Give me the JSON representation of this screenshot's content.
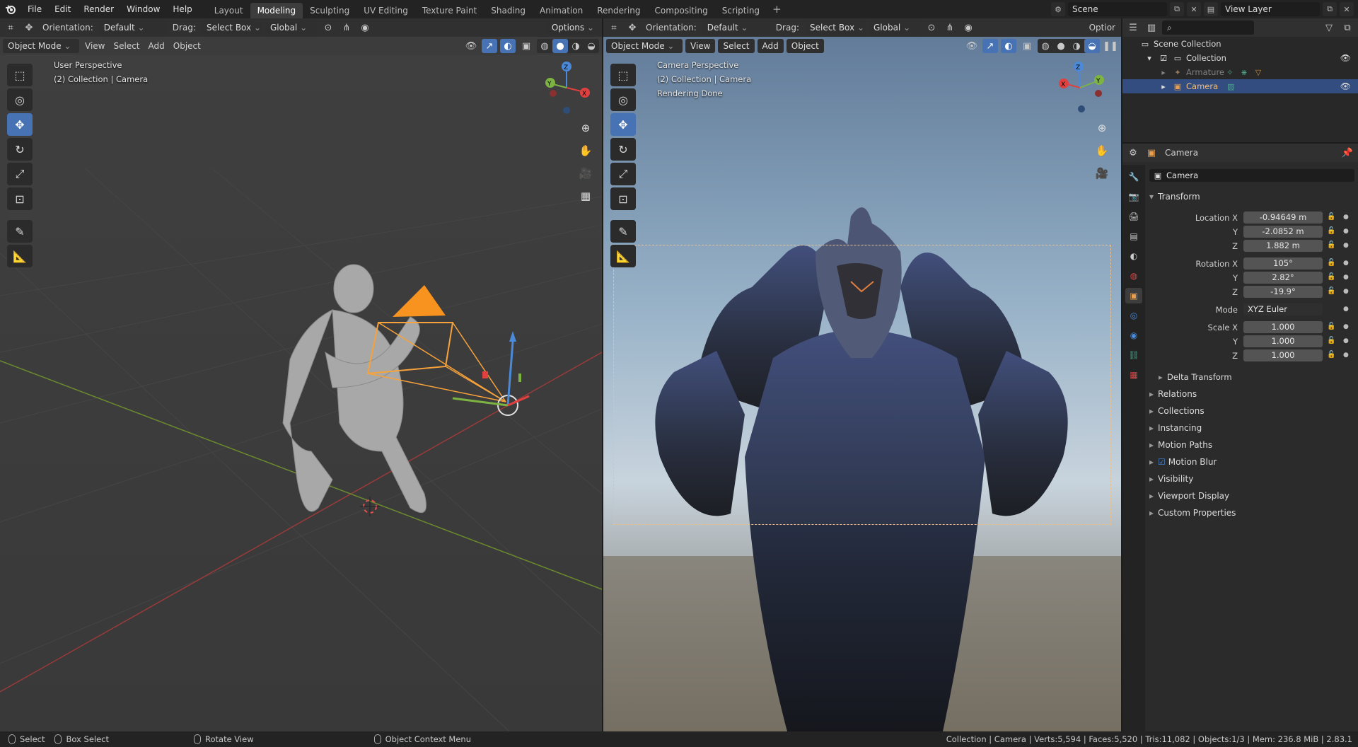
{
  "menubar": {
    "items": [
      "File",
      "Edit",
      "Render",
      "Window",
      "Help"
    ],
    "workspaces": [
      "Layout",
      "Modeling",
      "Sculpting",
      "UV Editing",
      "Texture Paint",
      "Shading",
      "Animation",
      "Rendering",
      "Compositing",
      "Scripting"
    ],
    "active_workspace": "Modeling",
    "add_tab": "+",
    "scene": "Scene",
    "view_layer": "View Layer"
  },
  "viewport_left": {
    "header": {
      "orientation_label": "Orientation:",
      "orientation_value": "Default",
      "drag_label": "Drag:",
      "drag_value": "Select Box",
      "transform_space": "Global",
      "options": "Options",
      "mode": "Object Mode",
      "view": "View",
      "select": "Select",
      "add": "Add",
      "object": "Object"
    },
    "overlay": {
      "perspective": "User Perspective",
      "context": "(2) Collection | Camera"
    }
  },
  "viewport_right": {
    "header": {
      "orientation_label": "Orientation:",
      "orientation_value": "Default",
      "drag_label": "Drag:",
      "drag_value": "Select Box",
      "transform_space": "Global",
      "options": "Optior",
      "mode": "Object Mode",
      "view": "View",
      "select": "Select",
      "add": "Add",
      "object": "Object"
    },
    "overlay": {
      "perspective": "Camera Perspective",
      "context": "(2) Collection | Camera",
      "status": "Rendering Done"
    }
  },
  "outliner": {
    "search_placeholder": "",
    "rows": [
      {
        "label": "Scene Collection"
      },
      {
        "label": "Collection"
      },
      {
        "label": "Armature"
      },
      {
        "label": "Camera"
      }
    ]
  },
  "properties": {
    "context_name": "Camera",
    "object_name": "Camera",
    "transform": {
      "title": "Transform",
      "location_label": "Location X",
      "location": [
        "-0.94649 m",
        "-2.0852 m",
        "1.882 m"
      ],
      "rotation_label": "Rotation X",
      "rotation": [
        "105°",
        "2.82°",
        "-19.9°"
      ],
      "mode_label": "Mode",
      "mode_value": "XYZ Euler",
      "scale_label": "Scale X",
      "scale": [
        "1.000",
        "1.000",
        "1.000"
      ],
      "y_label": "Y",
      "z_label": "Z",
      "delta": "Delta Transform"
    },
    "panels": [
      "Relations",
      "Collections",
      "Instancing",
      "Motion Paths",
      "Motion Blur",
      "Visibility",
      "Viewport Display",
      "Custom Properties"
    ]
  },
  "statusbar": {
    "select": "Select",
    "box_select": "Box Select",
    "rotate_view": "Rotate View",
    "context_menu": "Object Context Menu",
    "stats": "Collection | Camera | Verts:5,594 | Faces:5,520 | Tris:11,082 | Objects:1/3 | Mem: 236.8 MiB | 2.83.1"
  }
}
